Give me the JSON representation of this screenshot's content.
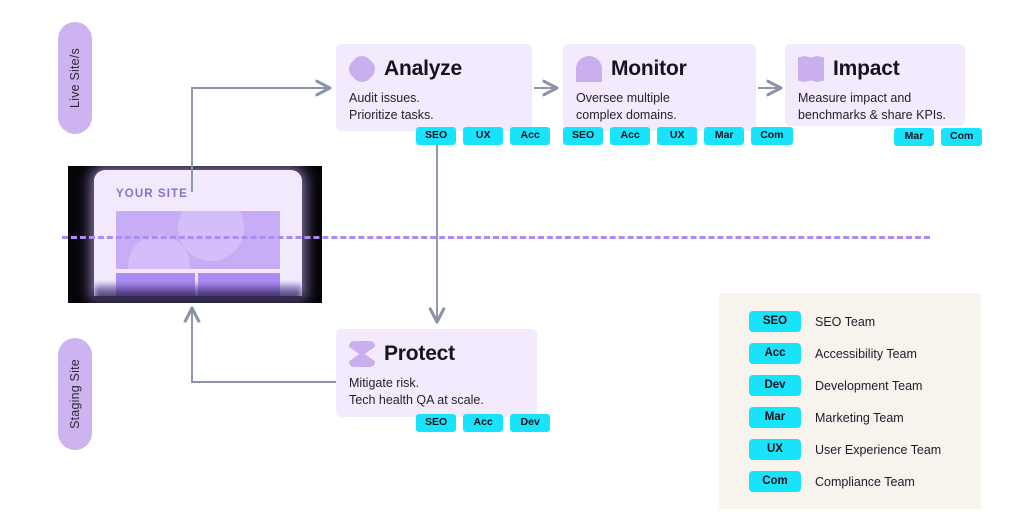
{
  "side_labels": {
    "live": "Live Site/s",
    "staging": "Staging Site"
  },
  "site_mockup": {
    "title": "YOUR SITE"
  },
  "cards": [
    {
      "id": "analyze",
      "title": "Analyze",
      "icon": "clover-icon",
      "description": "Audit issues.\nPrioritize tasks.",
      "chips": [
        "SEO",
        "UX",
        "Acc"
      ]
    },
    {
      "id": "monitor",
      "title": "Monitor",
      "icon": "arch-icon",
      "description": "Oversee multiple\ncomplex domains.",
      "chips": [
        "SEO",
        "Acc",
        "UX",
        "Mar",
        "Com"
      ]
    },
    {
      "id": "impact",
      "title": "Impact",
      "icon": "wave-banner-icon",
      "description": "Measure impact and\nbenchmarks & share KPIs.",
      "chips": [
        "Mar",
        "Com"
      ]
    },
    {
      "id": "protect",
      "title": "Protect",
      "icon": "hourglass-icon",
      "description": "Mitigate risk.\nTech health QA at scale.",
      "chips": [
        "SEO",
        "Acc",
        "Dev"
      ]
    }
  ],
  "legend": [
    {
      "code": "SEO",
      "label": "SEO Team"
    },
    {
      "code": "Acc",
      "label": "Accessibility Team"
    },
    {
      "code": "Dev",
      "label": "Development Team"
    },
    {
      "code": "Mar",
      "label": "Marketing Team"
    },
    {
      "code": "UX",
      "label": "User Experience Team"
    },
    {
      "code": "Com",
      "label": "Compliance Team"
    }
  ],
  "colors": {
    "chip_cyan": "#19e3fb",
    "card_lavender": "#f3ebfd",
    "icon_purple": "#c9afee",
    "pill_purple": "#cdb4f0",
    "dashed_purple": "#ab8cf5",
    "legend_cream": "#f7f4ee",
    "connector_gray": "#8b93a8"
  }
}
